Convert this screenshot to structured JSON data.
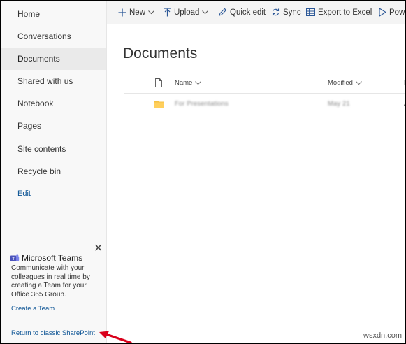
{
  "sidebar": {
    "items": [
      {
        "label": "Home"
      },
      {
        "label": "Conversations"
      },
      {
        "label": "Documents"
      },
      {
        "label": "Shared with us"
      },
      {
        "label": "Notebook"
      },
      {
        "label": "Pages"
      },
      {
        "label": "Site contents"
      },
      {
        "label": "Recycle bin"
      }
    ],
    "edit_label": "Edit",
    "active_item": "Documents"
  },
  "teams_card": {
    "title": "Microsoft Teams",
    "lines": [
      "Communicate with your",
      "colleagues in real time by",
      "creating a Team for your",
      "Office 365 Group."
    ],
    "link": "Create a Team",
    "close_symbol": "✕"
  },
  "return_link": "Return to classic SharePoint",
  "toolbar": {
    "new_label": "New",
    "upload_label": "Upload",
    "quick_edit_label": "Quick edit",
    "sync_label": "Sync",
    "export_label": "Export to Excel",
    "power_label": "Powe"
  },
  "main": {
    "title": "Documents",
    "columns": {
      "name": "Name",
      "modified": "Modified",
      "extra": "M"
    },
    "rows": [
      {
        "name": "For Presentations",
        "modified": "May 21",
        "extra": "A"
      }
    ]
  },
  "watermark": "wsxdn.com",
  "colors": {
    "link": "#0b5394",
    "sidebar_bg": "#f8f8f8",
    "active_bg": "#eaeaea",
    "arrow": "#d9001b",
    "folder": "#f5c243"
  }
}
